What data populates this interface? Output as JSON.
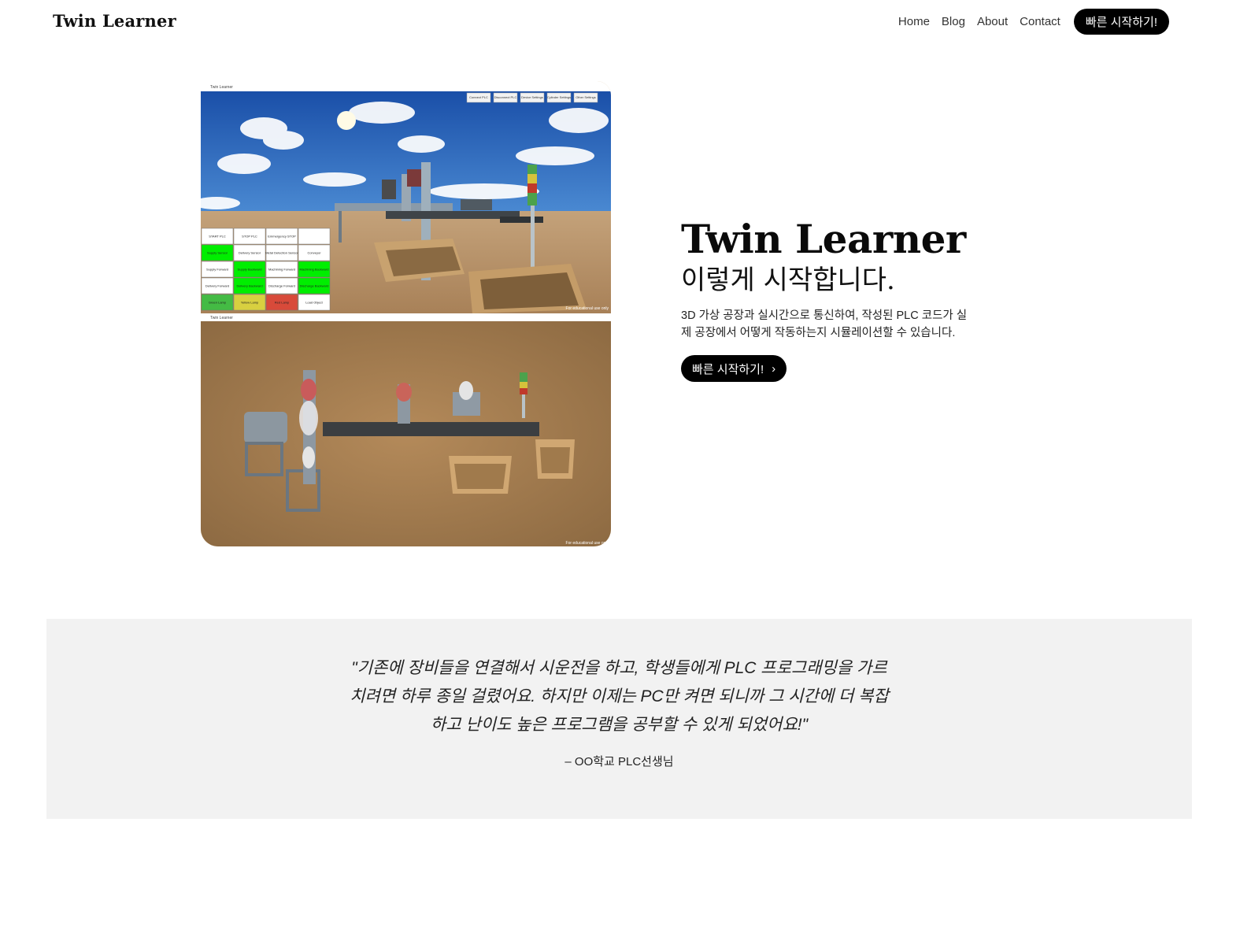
{
  "header": {
    "logo": "Twin Learner",
    "nav": [
      "Home",
      "Blog",
      "About",
      "Contact"
    ],
    "cta": "빠른 시작하기!"
  },
  "hero": {
    "title": "Twin Learner",
    "subtitle": "이렇게 시작합니다.",
    "description": "3D 가상 공장과 실시간으로 통신하여, 작성된 PLC 코드가 실제 공장에서 어떻게 작동하는지 시뮬레이션할 수 있습니다.",
    "button_label": "빠른 시작하기!",
    "button_icon": "chevron-right-icon",
    "screenshot": {
      "top_window_title": "Twin Learner",
      "bottom_window_title": "Twin Learner",
      "toolbar": [
        "Connect PLC",
        "Disconnect PLC",
        "Device Settings",
        "Cylinder Settings",
        "Other Settings"
      ],
      "watermark": "For educational use only",
      "panel_buttons": [
        {
          "label": "START PLC",
          "color": "#ffffff"
        },
        {
          "label": "STOP PLC",
          "color": "#ffffff"
        },
        {
          "label": "Emmergency STOP",
          "color": "#ffffff"
        },
        {
          "label": "",
          "color": "#ffffff"
        },
        {
          "label": "Supply Sensor",
          "color": "#00ee00"
        },
        {
          "label": "Delivery Sensor",
          "color": "#ffffff"
        },
        {
          "label": "Metal Detection Sensor",
          "color": "#ffffff"
        },
        {
          "label": "Conveyor",
          "color": "#ffffff"
        },
        {
          "label": "Supply Forward",
          "color": "#ffffff"
        },
        {
          "label": "Supply Backward",
          "color": "#00ee00"
        },
        {
          "label": "Machining Forward",
          "color": "#ffffff"
        },
        {
          "label": "Machining Backward",
          "color": "#00ee00"
        },
        {
          "label": "Delivery Forward",
          "color": "#ffffff"
        },
        {
          "label": "Delivery Backward",
          "color": "#00ee00"
        },
        {
          "label": "Discharge Forward",
          "color": "#ffffff"
        },
        {
          "label": "Discharge Backward",
          "color": "#00ee00"
        },
        {
          "label": "Green Lamp",
          "color": "#44bb44"
        },
        {
          "label": "Yellow Lamp",
          "color": "#d8d040"
        },
        {
          "label": "Red Lamp",
          "color": "#d84a3a"
        },
        {
          "label": "Load Object",
          "color": "#ffffff"
        }
      ]
    }
  },
  "testimonial": {
    "quote_line1": "\"기존에 장비들을 연결해서 시운전을 하고, 학생들에게 PLC 프로그래밍을 가르",
    "quote_line2": "치려면 하루 종일 걸렸어요. 하지만 이제는 PC만 켜면 되니까 그 시간에 더 복잡",
    "quote_line3": "하고 난이도 높은 프로그램을 공부할 수 있게 되었어요!\"",
    "author": "– OO학교 PLC선생님"
  }
}
